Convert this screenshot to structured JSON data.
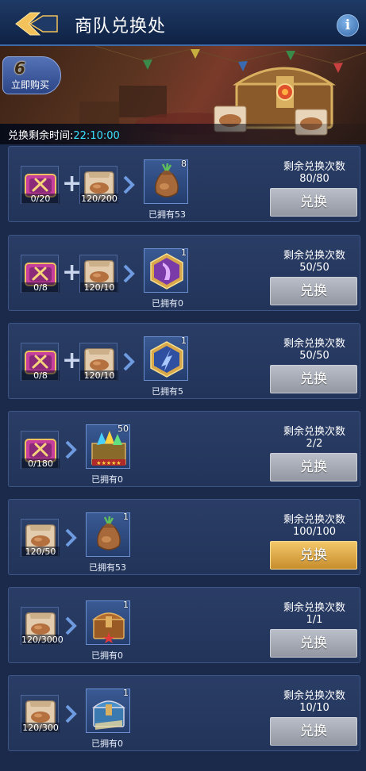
{
  "header": {
    "title": "商队兑换处"
  },
  "banner": {
    "buy_number": "6",
    "buy_label": "立即购买",
    "timer_label": "兑换剩余时间:",
    "timer_value": "22:10:00"
  },
  "remain_label": "剩余兑换次数",
  "button_label": "兑换",
  "rows": [
    {
      "costs": [
        "0/20",
        "120/200"
      ],
      "owned": "已拥有53",
      "qty": "8",
      "remaining": "80/80",
      "button_active": false
    },
    {
      "costs": [
        "0/8",
        "120/10"
      ],
      "owned": "已拥有0",
      "qty": "1",
      "remaining": "50/50",
      "button_active": false
    },
    {
      "costs": [
        "0/8",
        "120/10"
      ],
      "owned": "已拥有5",
      "qty": "1",
      "remaining": "50/50",
      "button_active": false
    },
    {
      "costs": [
        "0/180"
      ],
      "owned": "已拥有0",
      "qty": "50",
      "remaining": "2/2",
      "button_active": false
    },
    {
      "costs": [
        "120/50"
      ],
      "owned": "已拥有53",
      "qty": "1",
      "remaining": "100/100",
      "button_active": true
    },
    {
      "costs": [
        "120/3000"
      ],
      "owned": "已拥有0",
      "qty": "1",
      "remaining": "1/1",
      "button_active": false
    },
    {
      "costs": [
        "120/300"
      ],
      "owned": "已拥有0",
      "qty": "1",
      "remaining": "10/10",
      "button_active": false
    }
  ]
}
